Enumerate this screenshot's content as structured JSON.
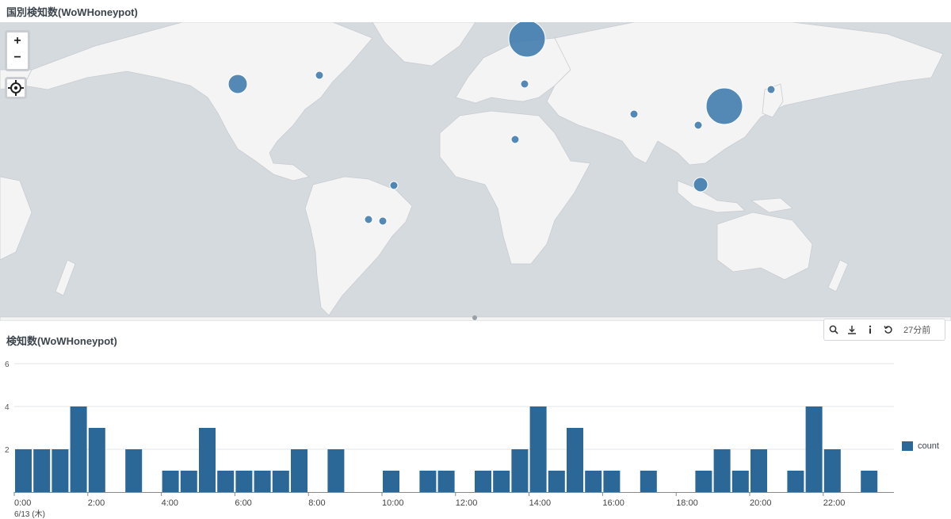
{
  "map_panel": {
    "title": "国別検知数(WoWHoneypot)",
    "controls": [
      "zoom-in",
      "zoom-out",
      "locate"
    ],
    "colors": {
      "water": "#d5dadf",
      "land": "#f4f4f4",
      "marker": "#3d7aad"
    },
    "markers": [
      {
        "location": "Russia",
        "size": "large"
      },
      {
        "location": "China",
        "size": "large"
      },
      {
        "location": "United States (west)",
        "size": "medium"
      },
      {
        "location": "Indonesia",
        "size": "small"
      },
      {
        "location": "United States (east)",
        "size": "small"
      },
      {
        "location": "Turkey",
        "size": "small"
      },
      {
        "location": "India",
        "size": "small"
      },
      {
        "location": "Vietnam",
        "size": "small"
      },
      {
        "location": "Japan",
        "size": "small"
      },
      {
        "location": "Nigeria",
        "size": "small"
      },
      {
        "location": "Brazil (northeast)",
        "size": "small"
      },
      {
        "location": "Brazil (south)",
        "size": "small"
      },
      {
        "location": "Brazil (southeast)",
        "size": "small"
      }
    ]
  },
  "chart_panel": {
    "title": "検知数(WoWHoneypot)",
    "toolbar": {
      "icons": [
        "search-icon",
        "download-icon",
        "info-icon",
        "refresh-icon"
      ],
      "refresh_time": "27分前"
    },
    "legend": {
      "label": "count",
      "color": "#2b6797"
    }
  },
  "chart_data": {
    "type": "bar",
    "title": "検知数(WoWHoneypot)",
    "xlabel": "",
    "ylabel": "",
    "ylim": [
      0,
      6
    ],
    "y_ticks": [
      "2",
      "4",
      "6"
    ],
    "x_ticks": [
      "0:00",
      "2:00",
      "4:00",
      "6:00",
      "8:00",
      "10:00",
      "12:00",
      "14:00",
      "16:00",
      "18:00",
      "20:00",
      "22:00"
    ],
    "x_sublabel": "6/13 (木)",
    "grid": true,
    "legend_position": "right",
    "interval_minutes": 30,
    "series": [
      {
        "name": "count",
        "color": "#2b6797",
        "values": [
          2,
          2,
          2,
          4,
          3,
          0,
          2,
          0,
          1,
          1,
          3,
          1,
          1,
          1,
          1,
          2,
          0,
          2,
          0,
          0,
          1,
          0,
          1,
          1,
          0,
          1,
          1,
          2,
          4,
          1,
          3,
          1,
          1,
          0,
          1,
          0,
          0,
          1,
          2,
          1,
          2,
          0,
          1,
          4,
          2,
          0,
          1,
          0
        ]
      }
    ]
  }
}
